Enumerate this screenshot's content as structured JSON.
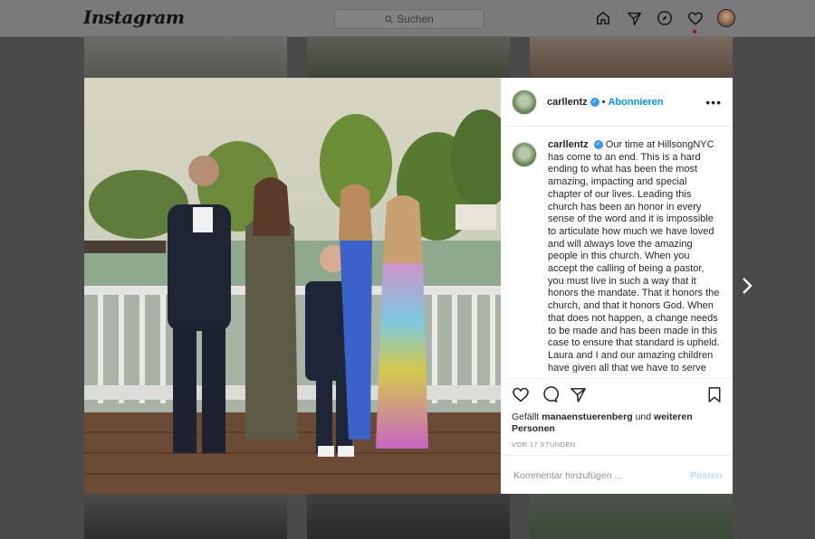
{
  "nav": {
    "logo": "Instagram",
    "search_placeholder": "Suchen",
    "icons": [
      "home-icon",
      "direct-icon",
      "explore-icon",
      "heart-icon",
      "profile-avatar"
    ]
  },
  "post": {
    "username": "carllentz",
    "verified": true,
    "separator": "•",
    "follow_label": "Abonnieren",
    "more_label": "•••",
    "caption": "Our time at HillsongNYC has come to an end. This is a hard ending to what has been the most amazing, impacting and special chapter of our lives. Leading this church has been an honor in every sense of the word and it is impossible to articulate how much we have loved and will always love the amazing people in this church. When you accept the calling of being a pastor, you must live in such a way that it honors the mandate. That it honors the church, and that it honors God. When that does not happen, a change needs to be made and has been made in this case to ensure that standard is upheld. Laura and I and our amazing children have given all that we have to serve",
    "likes_prefix": "Gefällt",
    "likes_user": "manaenstuerenberg",
    "likes_connector": "und",
    "likes_others": "weiteren Personen",
    "timestamp": "VOR 17 STUNDEN",
    "comment_placeholder": "Kommentar hinzufügen ...",
    "post_label": "Posten"
  },
  "colors": {
    "accent": "#0095f6",
    "verified": "#3897f0",
    "post_disabled": "#b2dffc",
    "overlay": "#4a4a4a"
  }
}
